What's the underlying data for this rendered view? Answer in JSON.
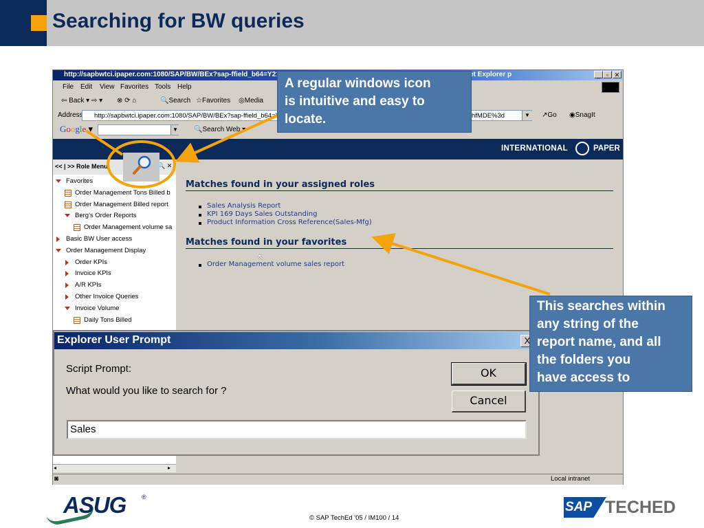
{
  "slide": {
    "title": "Searching for BW queries",
    "footer": "©  SAP TechEd '05 / IM100 / 14"
  },
  "browser": {
    "title": "http://sapbwtci.ipaper.com:1080/SAP/BW/BEx?sap-ffield_b64=Y21",
    "title_tail": "et Explorer p",
    "menu": [
      "File",
      "Edit",
      "View",
      "Favorites",
      "Tools",
      "Help"
    ],
    "toolbar": {
      "back": "Back",
      "search": "Search",
      "favorites": "Favorites",
      "media": "Media"
    },
    "address_label": "Address",
    "address_value": "http://sapbwtci.ipaper.com:1080/SAP/BW/BEx?sap-ffield_b64=Y2",
    "address_tail": "hfMDE%3d",
    "go": "Go",
    "snagit": "SnagIt",
    "google": "Google",
    "search_web": "Search Web",
    "status": "Local intranet"
  },
  "page": {
    "brand": "INTERNATIONAL",
    "brand_tail": "PAPER",
    "sidebar_header": "<< | >> Role Menu",
    "sidebar_items": [
      {
        "label": "Favorites",
        "type": "folder-open",
        "indent": 0
      },
      {
        "label": "Order Management Tons Billed b",
        "type": "doc",
        "indent": 1
      },
      {
        "label": "Order Management Billed report",
        "type": "doc",
        "indent": 1
      },
      {
        "label": "Berg's Order Reports",
        "type": "folder-open",
        "indent": 1
      },
      {
        "label": "Order Management volume sa",
        "type": "doc",
        "indent": 2
      },
      {
        "label": "Basic BW User access",
        "type": "folder-closed",
        "indent": 0
      },
      {
        "label": "Order Management Display",
        "type": "folder-open",
        "indent": 0
      },
      {
        "label": "Order KPIs",
        "type": "folder-closed",
        "indent": 1
      },
      {
        "label": "Invoice KPIs",
        "type": "folder-closed",
        "indent": 1
      },
      {
        "label": "A/R KPIs",
        "type": "folder-closed",
        "indent": 1
      },
      {
        "label": "Other Invoice Queries",
        "type": "folder-closed",
        "indent": 1
      },
      {
        "label": "Invoice Volume",
        "type": "folder-open",
        "indent": 1
      },
      {
        "label": "Daily Tons Billed",
        "type": "doc",
        "indent": 2
      }
    ],
    "roles_heading": "Matches found in your assigned roles",
    "roles_results": [
      "Sales Analysis Report",
      "KPI 169 Days Sales Outstanding",
      "Product Information Cross Reference(Sales-Mfg)"
    ],
    "favorites_heading": "Matches found in your favorites",
    "favorites_results": [
      "Order Management volume sales report"
    ]
  },
  "dialog": {
    "title": "Explorer User Prompt",
    "label": "Script Prompt:",
    "question": "What would you like to search for ?",
    "ok": "OK",
    "cancel": "Cancel",
    "input_value": "Sales",
    "close": "X"
  },
  "callouts": {
    "icon_note": [
      "A regular windows icon",
      " is intuitive and easy to",
      " locate."
    ],
    "search_note": [
      "This searches within",
      " any string of the",
      " report name, and all",
      " the folders you",
      " have access to"
    ]
  },
  "logos": {
    "asug": "ASUG",
    "sap": "SAP",
    "teched": "TECHED"
  },
  "colors": {
    "navy": "#0b2a5a",
    "orange": "#f4a30b",
    "callout": "#4a76a8",
    "arrow": "#f4a30b"
  }
}
